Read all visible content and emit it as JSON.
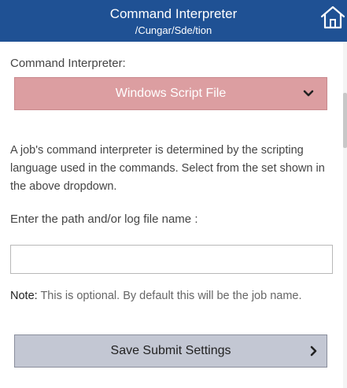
{
  "header": {
    "title": "Command Interpreter",
    "subtitle": "/Cungar/Sde/tion",
    "icon": "home-icon",
    "background": "#1f5194"
  },
  "interpreter": {
    "label": "Command Interpreter:",
    "selected_value": "Windows Script File",
    "dropdown_color": "#dc9ea1",
    "icon": "chevron-down-icon"
  },
  "description": "A job's command interpreter is determined by the scripting language used in the commands. Select from the set shown in the above dropdown.",
  "log_path": {
    "label": "Enter the path and/or log file name :",
    "value": ""
  },
  "note": {
    "label": "Note:",
    "text": " This is optional. By default this will be the job name."
  },
  "save": {
    "label": "Save Submit Settings",
    "icon": "chevron-right-icon",
    "button_color": "#c3c7d3"
  }
}
